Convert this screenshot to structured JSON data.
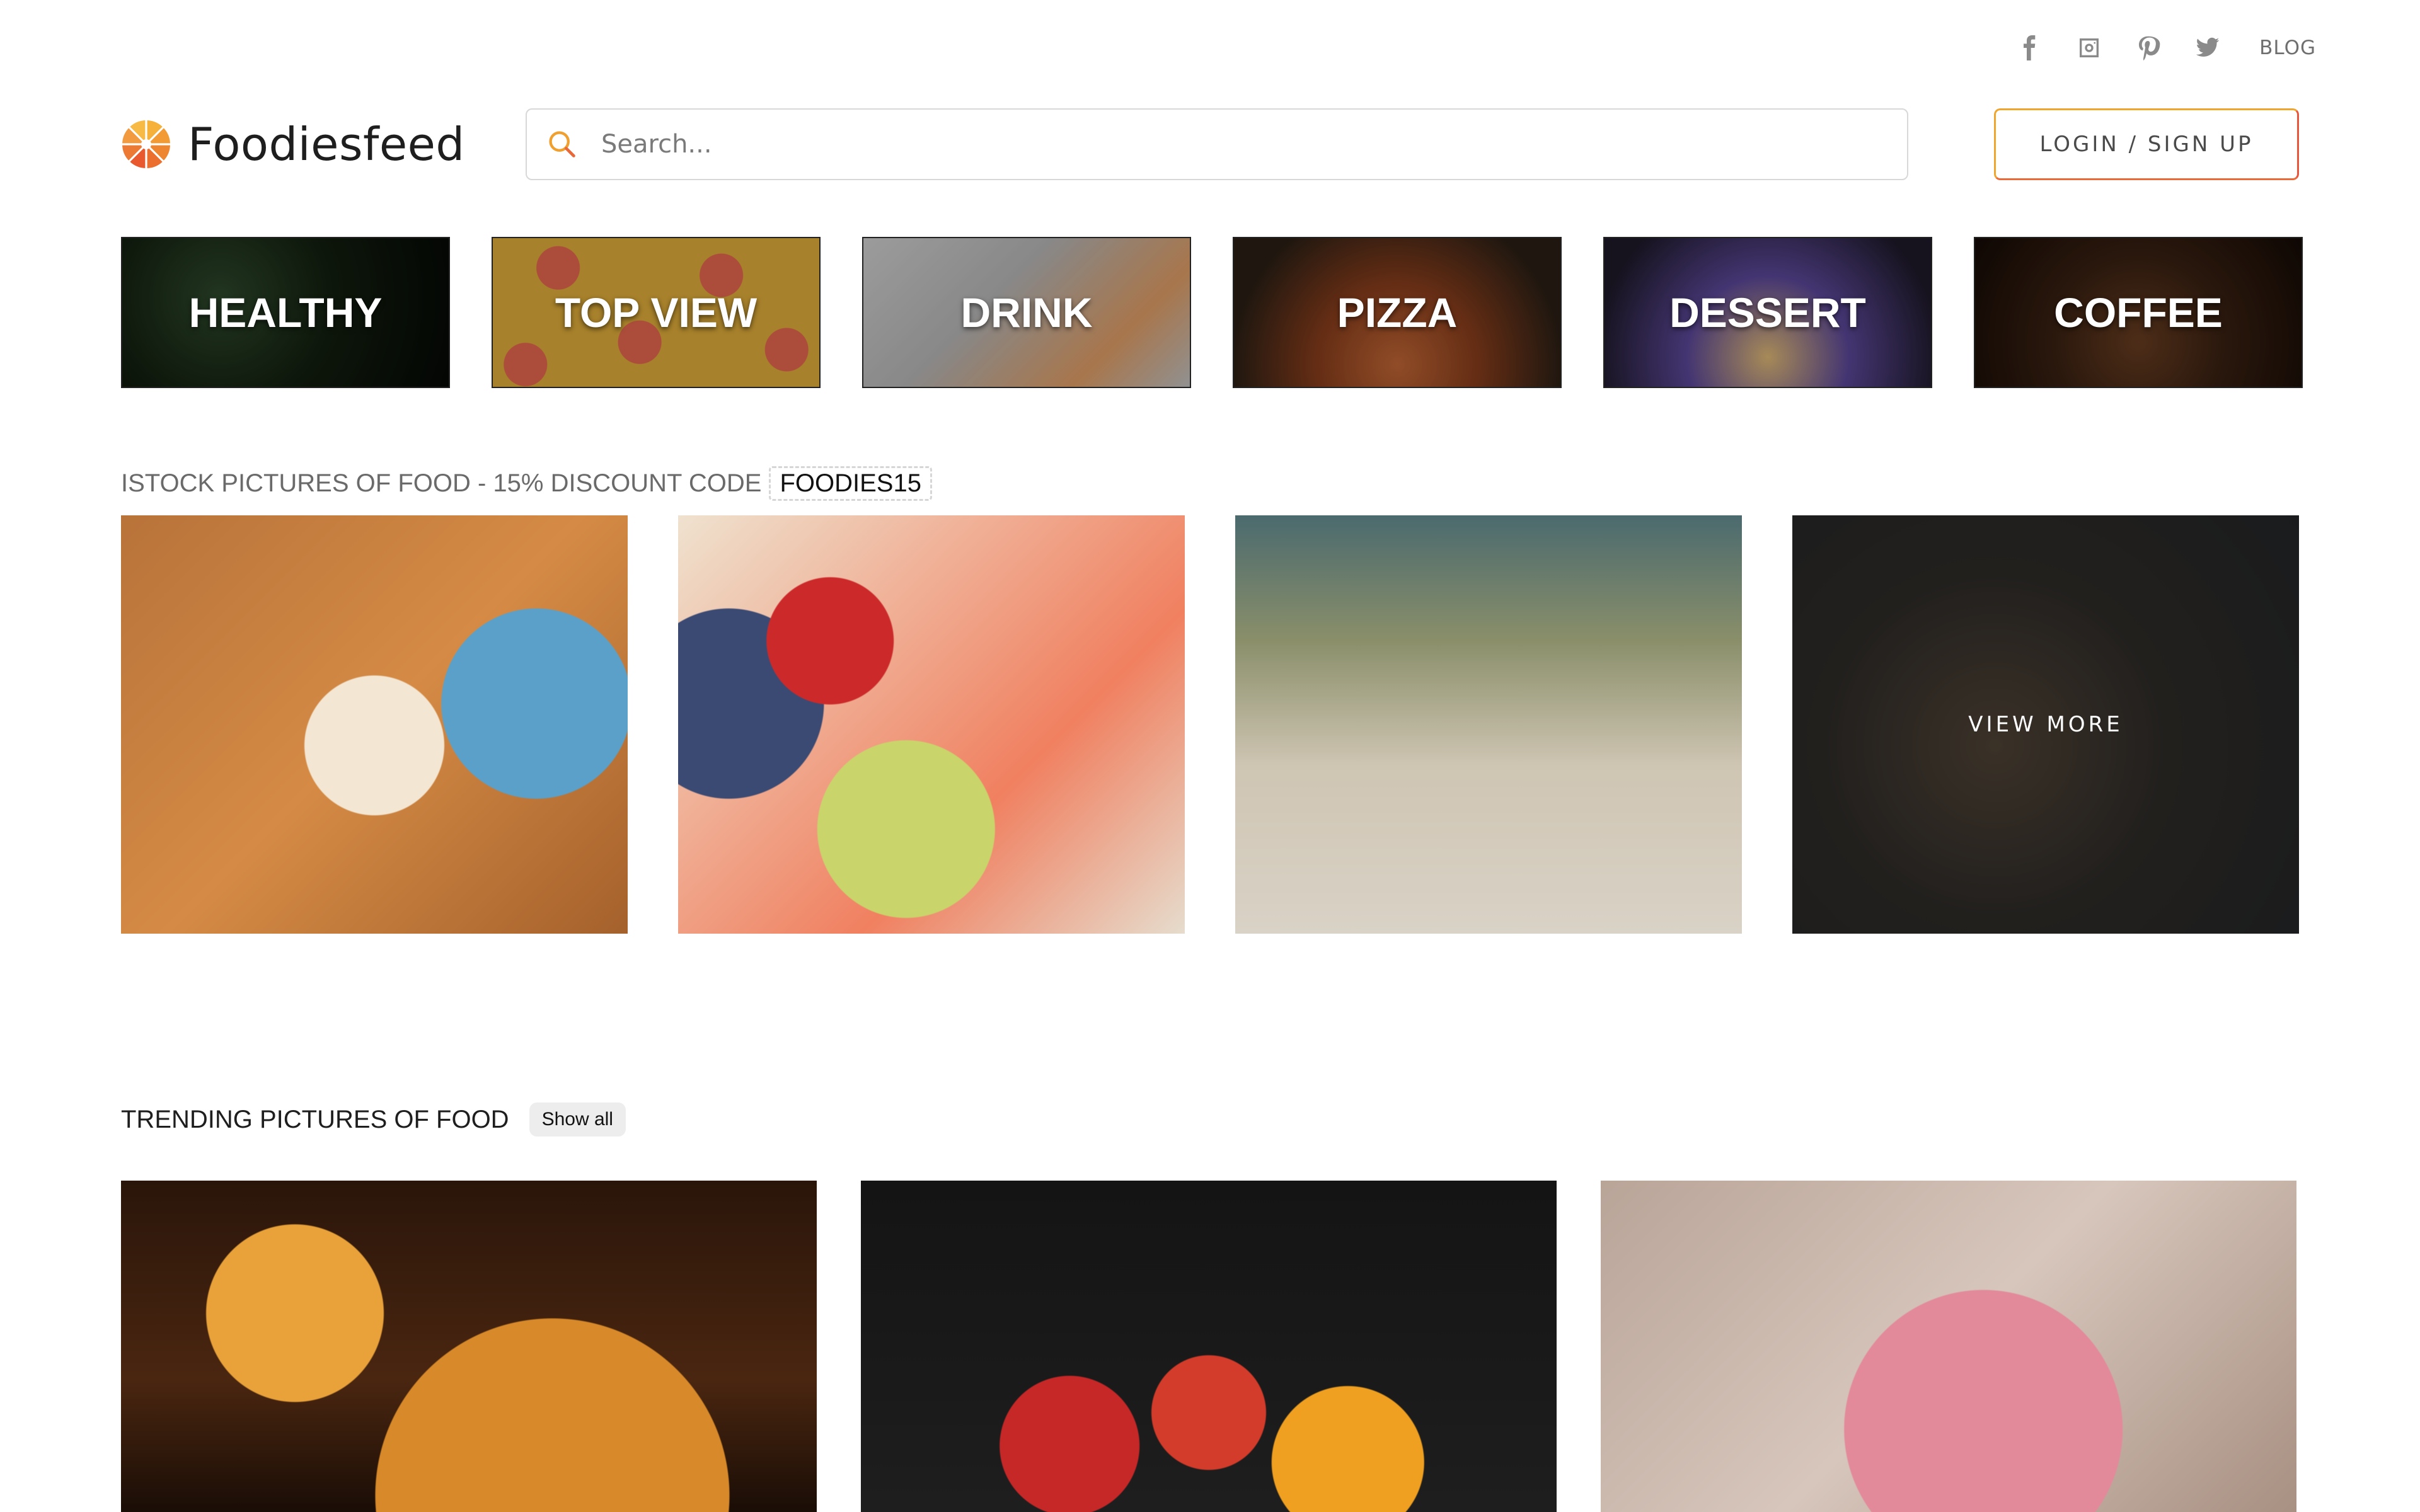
{
  "social": {
    "icons": [
      "facebook-icon",
      "instagram-icon",
      "pinterest-icon",
      "twitter-icon"
    ],
    "blog_label": "BLOG"
  },
  "header": {
    "logo_text": "Foodiesfeed",
    "search_placeholder": "Search...",
    "login_label": "LOGIN / SIGN UP"
  },
  "categories": [
    {
      "label": "HEALTHY"
    },
    {
      "label": "TOP VIEW"
    },
    {
      "label": "DRINK"
    },
    {
      "label": "PIZZA"
    },
    {
      "label": "DESSERT"
    },
    {
      "label": "COFFEE"
    }
  ],
  "istock": {
    "heading": "ISTOCK PICTURES OF FOOD - 15% DISCOUNT CODE",
    "code": "FOODIES15",
    "view_more_label": "VIEW MORE"
  },
  "trending": {
    "heading": "TRENDING PICTURES OF FOOD",
    "show_all_label": "Show all"
  },
  "colors": {
    "accent_orange": "#f0a52d",
    "accent_red": "#e8543c",
    "text_dark": "#1e1e1e",
    "text_muted": "#6a6a6a"
  }
}
